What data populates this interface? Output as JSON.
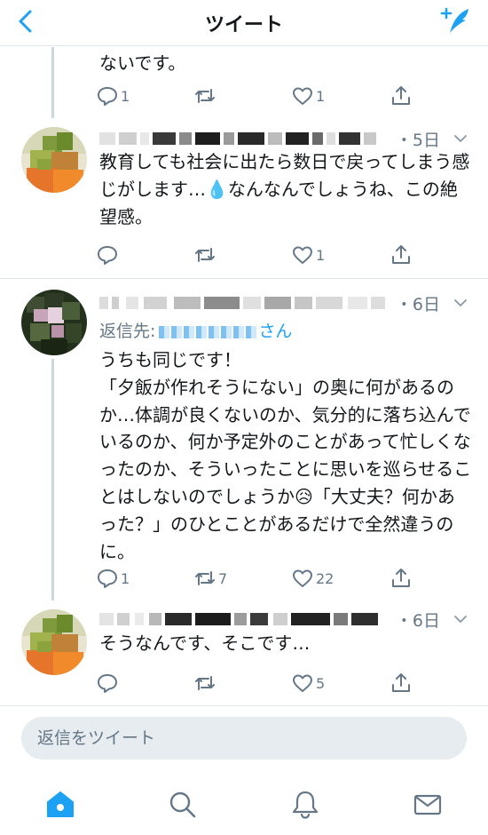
{
  "header": {
    "title": "ツイート",
    "back_icon": "chevron-left-icon",
    "compose_icon": "compose-tweet-icon",
    "accent_color": "#1da1f2"
  },
  "tweets": [
    {
      "text": "ないです。",
      "actions": {
        "reply": "1",
        "retweet": "",
        "like": "1"
      }
    },
    {
      "timestamp": "・5日",
      "text": "教育しても社会に出たら数日で戻ってしまう感じがします…💧なんなんでしょうね、この絶望感。",
      "actions": {
        "reply": "",
        "retweet": "",
        "like": "1"
      }
    },
    {
      "timestamp": "・6日",
      "reply_to_label": "返信先:",
      "reply_to_suffix": "さん",
      "text": "うちも同じです！\n「夕飯が作れそうにない」の奥に何があるのか…体調が良くないのか、気分的に落ち込んでいるのか、何か予定外のことがあって忙しくなったのか、そういったことに思いを巡らせることはしないのでしょうか😥「大丈夫？何かあった？」のひとことがあるだけで全然違うのに。",
      "actions": {
        "reply": "1",
        "retweet": "7",
        "like": "22"
      }
    },
    {
      "timestamp": "・6日",
      "text": "そうなんです、そこです…",
      "actions": {
        "reply": "",
        "retweet": "",
        "like": "5"
      }
    }
  ],
  "composer": {
    "placeholder": "返信をツイート"
  },
  "tabbar": {
    "items": [
      "home-icon",
      "search-icon",
      "notifications-icon",
      "messages-icon"
    ],
    "active": "home-icon"
  }
}
